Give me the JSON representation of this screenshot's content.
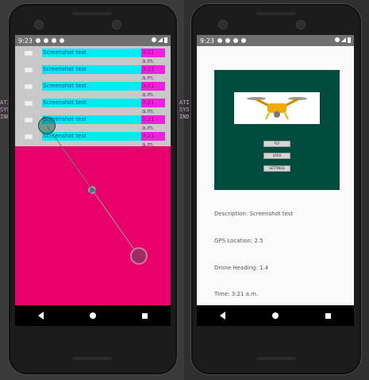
{
  "left_phone": {
    "status_time": "9:23",
    "notifications": [
      {
        "title": "Screenshot test",
        "time": "3:21 a.m."
      },
      {
        "title": "Screenshot test",
        "time": "3:21 a.m."
      },
      {
        "title": "Screenshot test",
        "time": "3:21 a.m."
      },
      {
        "title": "Screenshot test",
        "time": "3:21 a.m."
      },
      {
        "title": "Screenshot test",
        "time": "3:21 a.m."
      },
      {
        "title": "Screenshot test",
        "time": "3:21 a.m."
      }
    ],
    "background_color": "#e8006b",
    "notification_panel_color": "#c8c8c8"
  },
  "right_phone": {
    "status_time": "9:23",
    "buttons": [
      "FLY",
      "LOGS",
      "SETTINGS"
    ],
    "description_label": "Description: Screenshot test",
    "gps_label": "GPS Location: 2.5",
    "heading_label": "Drone Heading: 1.4",
    "time_label": "Time: 3:21 a.m.",
    "panel_color": "#004d40"
  },
  "side_texts": {
    "left": "ATI SYS IND",
    "right": "ATI SYS IND"
  },
  "icons": {
    "back": "back-triangle-icon",
    "home": "home-circle-icon",
    "recent": "recent-square-icon"
  }
}
